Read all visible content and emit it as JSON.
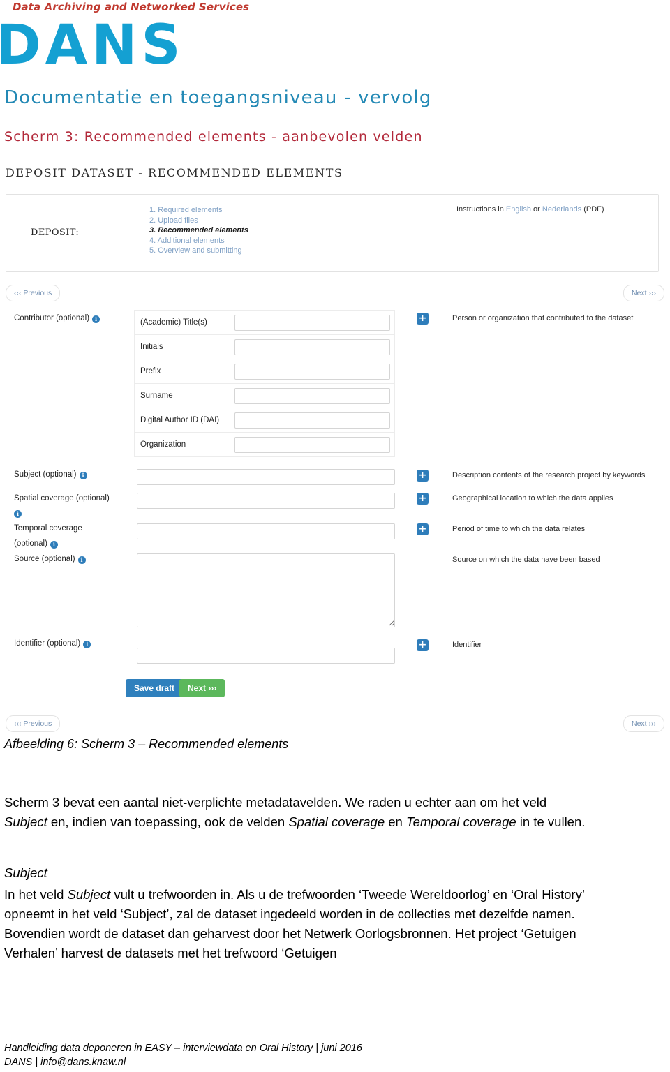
{
  "header": {
    "tagline": "Data Archiving and Networked Services",
    "logo": "DANS",
    "title": "Documentatie en toegangsniveau - vervolg",
    "subtitle": "Scherm 3: Recommended elements - aanbevolen velden",
    "logo_color": "#14a0d2",
    "title_color": "#2389b5",
    "subtitle_color": "#b2293a",
    "tagline_color": "#c0392f"
  },
  "screenshot": {
    "title": "DEPOSIT DATASET - RECOMMENDED ELEMENTS",
    "deposit_label": "DEPOSIT:",
    "steps": [
      "1. Required elements",
      "2. Upload files",
      "3. Recommended elements",
      "4. Additional elements",
      "5. Overview and submitting"
    ],
    "active_step_index": 2,
    "instructions": {
      "prefix": "Instructions in ",
      "link1": "English",
      "middle": " or ",
      "link2": "Nederlands",
      "suffix": " (PDF)"
    },
    "nav": {
      "previous": "‹‹‹ Previous",
      "next": "Next ›››"
    },
    "contributor": {
      "label": "Contributor (optional)",
      "hint": "Person or organization that contributed to the dataset",
      "rows": [
        "(Academic) Title(s)",
        "Initials",
        "Prefix",
        "Surname",
        "Digital Author ID (DAI)",
        "Organization"
      ]
    },
    "fields": [
      {
        "label": "Subject (optional)",
        "hint": "Description contents of the research project by keywords"
      },
      {
        "label": "Spatial coverage (optional)",
        "hint": "Geographical location to which the data applies"
      },
      {
        "label": "Temporal coverage",
        "label2": "(optional)",
        "hint": "Period of time to which the data relates"
      },
      {
        "label": "Source (optional)",
        "hint": "Source on which the data have been based"
      },
      {
        "label": "Identifier (optional)",
        "hint": "Identifier"
      }
    ],
    "buttons": {
      "save_draft": "Save draft",
      "next": "Next ›››"
    },
    "accent_blue": "#2e7dba",
    "accent_green": "#5cb85c"
  },
  "caption": "Afbeelding 6: Scherm 3 – Recommended elements",
  "body": {
    "p1_a": "Scherm 3 bevat een aantal niet-verplichte metadatavelden. We raden u echter aan om het veld ",
    "p1_i1": "Subject",
    "p1_b": " en, indien van toepassing, ook de velden ",
    "p1_i2": "Spatial coverage",
    "p1_c": " en ",
    "p1_i3": "Temporal coverage",
    "p1_d": " in te vullen.",
    "subject_heading": "Subject",
    "p2_a": "In het veld ",
    "p2_i1": "Subject",
    "p2_b": " vult u trefwoorden in. Als u de trefwoorden ‘Tweede Wereldoorlog’ en ‘Oral History’ opneemt in het veld ‘Subject’, zal de dataset ingedeeld worden in de collecties met dezelfde namen. Bovendien wordt de dataset dan geharvest door het Netwerk Oorlogsbronnen. Het project ‘Getuigen Verhalen’ harvest de datasets met het trefwoord ‘Getuigen"
  },
  "footer": {
    "line1": "Handleiding data deponeren in EASY – interviewdata en Oral History | juni 2016",
    "line2": "DANS | info@dans.knaw.nl"
  }
}
